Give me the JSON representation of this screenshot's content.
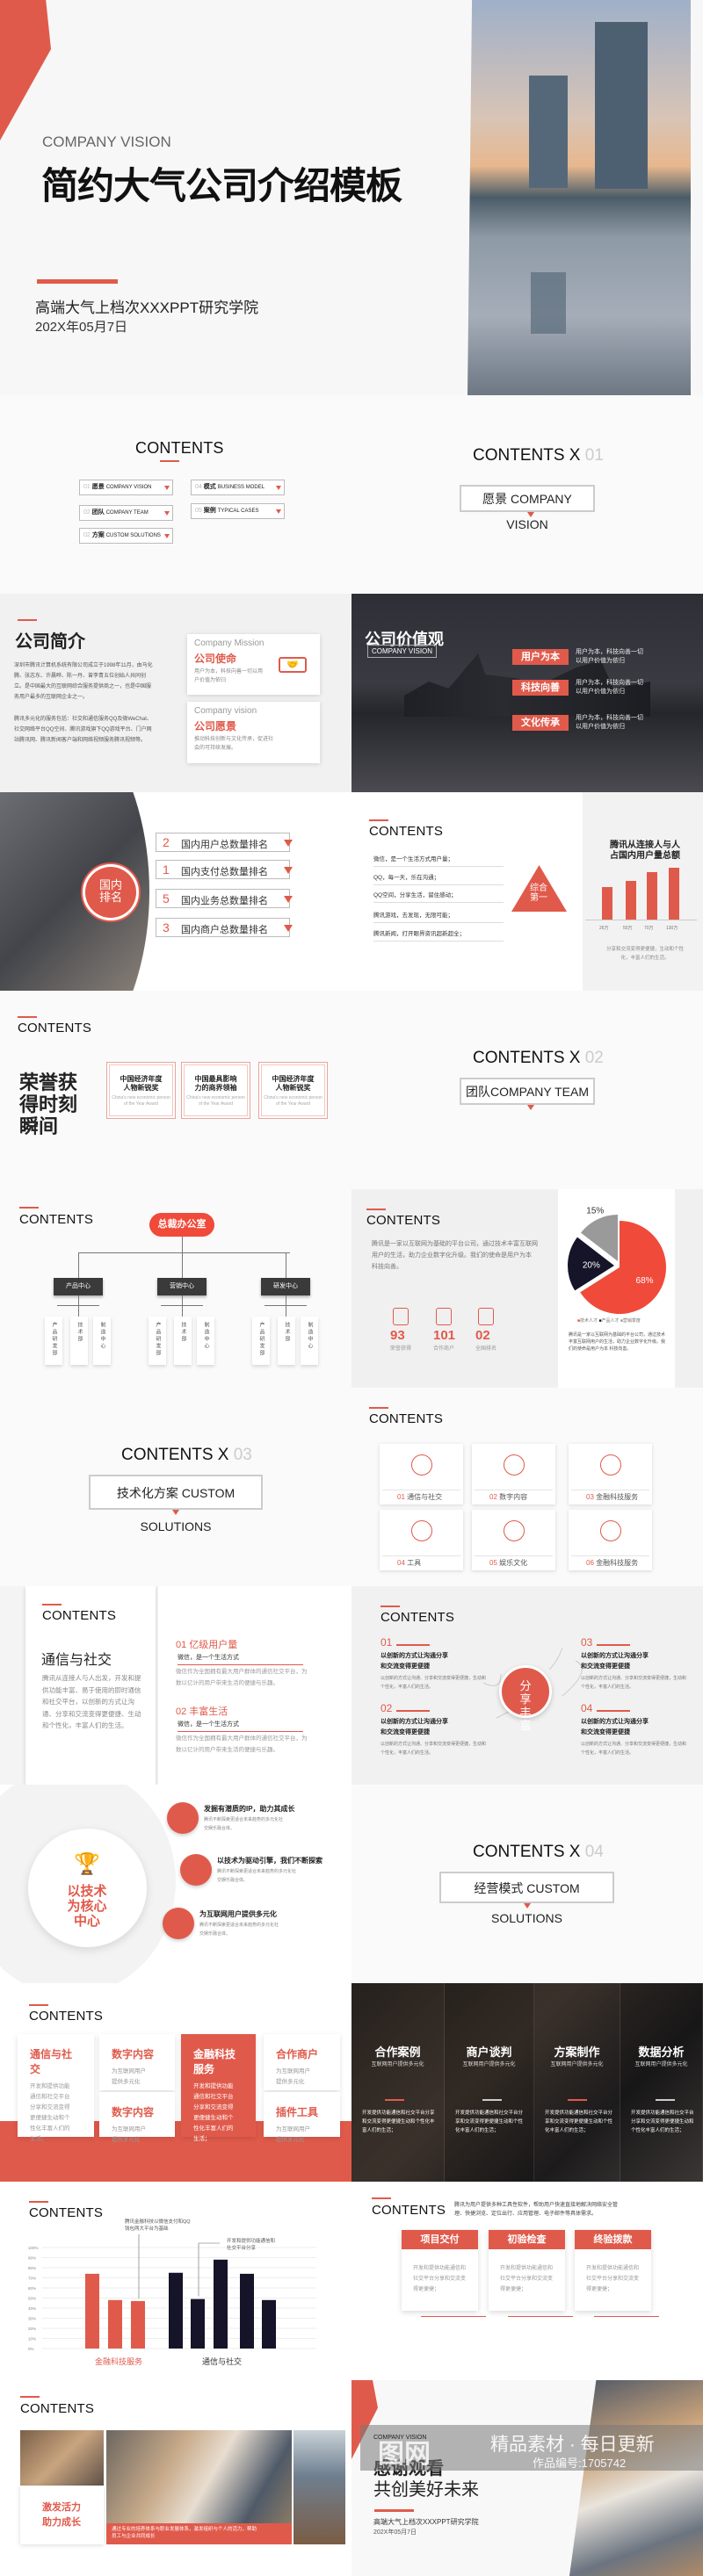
{
  "colors": {
    "accent": "#e05a4b",
    "navy": "#151428",
    "gray": "#9a9a9a"
  },
  "contents_label": "CONTENTS",
  "cover": {
    "eyebrow": "COMPANY VISION",
    "title": "简约大气公司介绍模板",
    "org": "高端大气上档次XXXPPT研究学院",
    "date": "202X年05月7日"
  },
  "toc": {
    "items": [
      {
        "num": "01",
        "cn": "愿景",
        "en": "COMPANY VISION"
      },
      {
        "num": "02",
        "cn": "团队",
        "en": "COMPANY TEAM"
      },
      {
        "num": "02",
        "cn": "方案",
        "en": "CUSTOM SOLUTIONS"
      },
      {
        "num": "04",
        "cn": "模式",
        "en": "BUSINESS MODEL"
      },
      {
        "num": "05",
        "cn": "案例",
        "en": "TYPICAL CASES"
      }
    ]
  },
  "sections": [
    {
      "title": "CONTENTS X",
      "num": "01",
      "label": "愿景 COMPANY VISION"
    },
    {
      "title": "CONTENTS X",
      "num": "02",
      "label": "团队COMPANY TEAM"
    },
    {
      "title": "CONTENTS X",
      "num": "03",
      "label": "技术化方案 CUSTOM SOLUTIONS"
    },
    {
      "title": "CONTENTS X",
      "num": "04",
      "label": "经营模式 CUSTOM SOLUTIONS"
    }
  ],
  "intro": {
    "title": "公司简介",
    "p1": "深圳市腾讯计算机系统有限公司成立于1998年11月，由马化腾、张志东、许晨晔、陈一丹、曾李青五位创始人共同创立。是中国最大的互联网综合服务提供商之一，也是中国服务用户最多的互联网企业之一。",
    "p2": "腾讯多元化的服务包括：社交和通信服务QQ及微WeChat、社交网络平台QQ空间、腾讯游戏旗下QQ游戏平台、门户网站腾讯网、腾讯新闻客户端和网络视频服务腾讯视频等。",
    "cards": [
      {
        "en": "Company Mission",
        "cn": "公司使命",
        "text": "用户为本，科技向善一切以用户价值为依归"
      },
      {
        "en": "Company vision",
        "cn": "公司愿景",
        "text": "推动科技创新与文化传承，促进社会的可持续发展。"
      }
    ]
  },
  "values": {
    "title": "公司价值观",
    "badge": "COMPANY VISION",
    "items": [
      {
        "label": "用户为本",
        "text": "用户为本，科技向善一切以用户价值为依归"
      },
      {
        "label": "科技向善",
        "text": "用户为本，科技向善一切以用户价值为依归"
      },
      {
        "label": "文化传承",
        "text": "用户为本，科技向善一切以用户价值为依归"
      }
    ]
  },
  "ranking": {
    "circle": "国内排名",
    "items": [
      {
        "num": "2",
        "text": "国内用户总数量排名"
      },
      {
        "num": "1",
        "text": "国内支付总数量排名"
      },
      {
        "num": "5",
        "text": "国内业务总数量排名"
      },
      {
        "num": "3",
        "text": "国内商户总数量排名"
      }
    ]
  },
  "products": {
    "list": [
      "微信，是一个生活方式用户量；",
      "QQ，每一天，乐在沟通；",
      "QQ空间，分享生活，留住感动；",
      "腾讯游戏，去发现，无限可能；",
      "腾讯新闻，打开眼界资讯超新超全；"
    ],
    "triangle": "综合第一",
    "side_title": "腾讯从连接人与人占国内用户量总额",
    "caption": "分享和交流变得更便捷，生动和个性化，丰富人们的生活。"
  },
  "mini_chart": {
    "type": "bar",
    "categories": [
      "26万",
      "50万",
      "70万",
      "130万"
    ],
    "values": [
      26,
      50,
      70,
      130
    ]
  },
  "honors": {
    "title": "荣誉获得时刻瞬间",
    "awards": [
      {
        "cn": "中国经济年度人物新锐奖",
        "en": "China's new economic person of the Year Award"
      },
      {
        "cn": "中国最具影响力的商界领袖",
        "en": "China's new economic person of the Year Award"
      },
      {
        "cn": "中国经济年度人物新锐奖",
        "en": "China's new economic person of the Year Award"
      }
    ]
  },
  "org": {
    "root": "总裁办公室",
    "centers": [
      {
        "name": "产品中心",
        "subs": [
          "产品研发部",
          "技术部",
          "制造中心"
        ]
      },
      {
        "name": "营销中心",
        "subs": [
          "产品研发部",
          "技术部",
          "制造中心"
        ]
      },
      {
        "name": "研发中心",
        "subs": [
          "产品研发部",
          "技术部",
          "制造中心"
        ]
      }
    ]
  },
  "stats": {
    "text": "腾讯是一家以互联网为基础的平台公司，通过技术丰富互联网用户的生活，助力企业数字化升级。我们的使命是用户为本 科技向善。",
    "items": [
      {
        "value": "93",
        "label": "荣誉获得",
        "icon": "trophy-icon"
      },
      {
        "value": "101",
        "label": "合作商户",
        "icon": "handshake-icon"
      },
      {
        "value": "02",
        "label": "全国排名",
        "icon": "certificate-icon"
      }
    ],
    "pie_note": "腾讯是一家以互联网为基础的平台公司，通过技术丰富互联网用户的生活，助力企业数字化升级。我们的使命是用户为本 科技向善。"
  },
  "chart_data": [
    {
      "type": "pie",
      "slices": [
        {
          "name": "技术人才",
          "value": 68,
          "label": "68%",
          "color": "#f04a3a"
        },
        {
          "name": "产品人才",
          "value": 20,
          "label": "20%",
          "color": "#151428"
        },
        {
          "name": "营销季度",
          "value": 15,
          "label": "15%",
          "color": "#9a9a9a"
        }
      ],
      "legend": "bottom"
    },
    {
      "type": "bar",
      "categories": [
        "金融科技服务",
        "通信与社交"
      ],
      "ylim": [
        0,
        100
      ],
      "yticks": [
        "0%",
        "10%",
        "20%",
        "30%",
        "40%",
        "50%",
        "60%",
        "70%",
        "80%",
        "90%",
        "100%"
      ],
      "series": [
        {
          "category": "金融科技服务",
          "values": [
            74,
            48,
            47
          ],
          "color": "#e05a4b"
        },
        {
          "category": "通信与社交",
          "values": [
            75,
            49,
            88,
            74,
            48
          ],
          "color": "#151428"
        }
      ],
      "annotations": [
        "腾讯金融科技以微信支付和QQ钱包两大平台为基础",
        "开发和提供功能通信和社交平台分享"
      ],
      "grid": true
    }
  ],
  "services": {
    "items": [
      {
        "num": "01",
        "label": "通信与社交",
        "icon": "cloud-signal-icon"
      },
      {
        "num": "02",
        "label": "数字内容",
        "icon": "lightbulb-icon"
      },
      {
        "num": "03",
        "label": "金融科技服务",
        "icon": "wallet-icon"
      },
      {
        "num": "04",
        "label": "工具",
        "icon": "target-icon"
      },
      {
        "num": "05",
        "label": "娱乐文化",
        "icon": "phone-dollar-icon"
      },
      {
        "num": "06",
        "label": "金融科技服务",
        "icon": "wifi-icon"
      }
    ]
  },
  "social": {
    "title": "通信与社交",
    "text": "腾讯从连接人与人出发，开发和提供功能丰富、易于使用的即时通信和社交平台，以创新的方式让沟通、分享和交流变得更便捷、生动和个性化，丰富人们的生活。",
    "items": [
      {
        "head": "01 亿级用户量",
        "sub": "微信，是一个生活方式",
        "text": "微信作为全国拥有最大用户群体的通信社交平台，为数以亿计的用户带来生活的便捷与乐趣。"
      },
      {
        "head": "02 丰富生活",
        "sub": "微信，是一个生活方式",
        "text": "微信作为全国拥有最大用户群体的通信社交平台，为数以亿计的用户带来生活的便捷与乐趣。"
      }
    ]
  },
  "share": {
    "center": "分享丰富",
    "items": [
      {
        "num": "01",
        "title": "以创新的方式让沟通分享和交流变得更便捷",
        "text": "以创新的方式让沟通、分享和交流变得更便捷，生动和个性化，丰富人们的生活。"
      },
      {
        "num": "02",
        "title": "以创新的方式让沟通分享和交流变得更便捷",
        "text": "以创新的方式让沟通、分享和交流变得更便捷，生动和个性化，丰富人们的生活。"
      },
      {
        "num": "03",
        "title": "以创新的方式让沟通分享和交流变得更便捷",
        "text": "以创新的方式让沟通、分享和交流变得更便捷，生动和个性化，丰富人们的生活。"
      },
      {
        "num": "04",
        "title": "以创新的方式让沟通分享和交流变得更便捷",
        "text": "以创新的方式让沟通、分享和交流变得更便捷，生动和个性化，丰富人们的生活。"
      }
    ]
  },
  "core": {
    "center": "以技术为核心中心",
    "items": [
      {
        "title": "发掘有潜质的IP，助力其成长",
        "text": "腾讯不断探索更适合未来趋势的多元化社交娱乐融合体。",
        "icon": "trophy-icon"
      },
      {
        "title": "以技术为驱动引擎，我们不断探索",
        "text": "腾讯不断探索更适合未来趋势的多元化社交娱乐融合体。",
        "icon": "handshake-icon"
      },
      {
        "title": "为互联网用户提供多元化",
        "text": "腾讯不断探索更适合未来趋势的多元化社交娱乐融合体。",
        "icon": "certificate-icon"
      }
    ]
  },
  "business": {
    "cards": [
      {
        "title": "通信与社交",
        "text": "开发和提供功能通信和社交平台分享和交流变得更便捷生动和个性化丰富人们的生活；"
      },
      {
        "title": "数字内容",
        "text": "为互联网用户提供多元化"
      },
      {
        "title": "数字内容",
        "text": "为互联网用户提供多元化"
      },
      {
        "title": "金融科技服务",
        "text": "开发和提供功能通信和社交平台分享和交流变得更便捷生动和个性化丰富人们的生活；"
      },
      {
        "title": "合作商户",
        "text": "为互联网用户提供多元化"
      },
      {
        "title": "插件工具",
        "text": "为互联网用户提供多元化"
      }
    ]
  },
  "cases": {
    "items": [
      {
        "title": "合作案例",
        "sub": "互联网用户提供多元化",
        "text": "开发提供功能通信和社交平台分享和交流变得更便捷生动和个性化丰富人们的生活；"
      },
      {
        "title": "商户谈判",
        "sub": "互联网用户提供多元化",
        "text": "开发提供功能通信和社交平台分享和交流变得更便捷生动和个性化丰富人们的生活；"
      },
      {
        "title": "方案制作",
        "sub": "互联网用户提供多元化",
        "text": "开发提供功能通信和社交平台分享和交流变得更便捷生动和个性化丰富人们的生活；"
      },
      {
        "title": "数据分析",
        "sub": "互联网用户提供多元化",
        "text": "开发提供功能通信和社交平台分享和交流变得更便捷生动和个性化丰富人们的生活；"
      }
    ]
  },
  "process": {
    "intro": "腾讯为用户提供多种工具性软件，帮助用户快速直接地解决网络安全管理、快捷浏览、定位出行、应用管理、电子邮件等具体需求。",
    "steps": [
      {
        "title": "项目交付",
        "text": "开发和提供功能通信和社交平台分享和交流变得更便捷；"
      },
      {
        "title": "初验检查",
        "text": "开发和提供功能通信和社交平台分享和交流变得更便捷；"
      },
      {
        "title": "终验拨款",
        "text": "开发和提供功能通信和社交平台分享和交流变得更便捷；"
      }
    ]
  },
  "growth": {
    "title": "激发活力助力成长",
    "caption": "通过专业的培养体系与职业发展体系，激发组织与个人的活力，帮助员工与企业共同成长"
  },
  "ending": {
    "eyebrow": "COMPANY VISION",
    "title": "感谢观看",
    "subtitle": "共创美好未来",
    "org": "高端大气上档次XXXPPT研究学院",
    "date": "202X年05月7日"
  },
  "watermark": {
    "logo": "图网",
    "slogan": "精品素材 · 每日更新",
    "code": "作品编号:1705742"
  }
}
